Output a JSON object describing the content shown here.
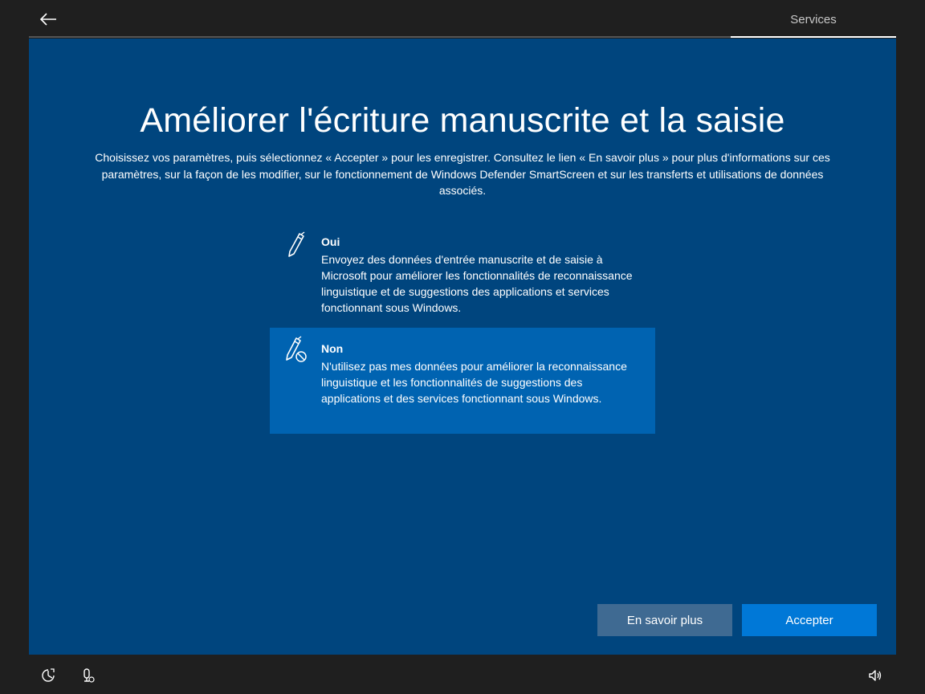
{
  "header": {
    "back_icon": "back-arrow-icon",
    "section_label": "Services"
  },
  "main": {
    "title": "Améliorer l'écriture manuscrite et la saisie",
    "subtitle": "Choisissez vos paramètres, puis sélectionnez « Accepter » pour les enregistrer. Consultez le lien « En savoir plus » pour plus d'informations sur ces paramètres, sur la façon de les modifier, sur le fonctionnement de Windows Defender SmartScreen et sur les transferts et utilisations de données associés.",
    "options": [
      {
        "icon": "pen-icon",
        "title": "Oui",
        "description": "Envoyez des données d'entrée manuscrite et de saisie à Microsoft pour améliorer les fonctionnalités de reconnaissance linguistique et de suggestions des applications et services fonctionnant sous Windows.",
        "selected": false
      },
      {
        "icon": "pen-blocked-icon",
        "title": "Non",
        "description": "N'utilisez pas mes données pour améliorer la reconnaissance linguistique et les fonctionnalités de suggestions des applications et des services fonctionnant sous Windows.",
        "selected": true
      }
    ]
  },
  "buttons": {
    "learn_more": "En savoir plus",
    "accept": "Accepter"
  },
  "footer": {
    "icons": [
      "ease-of-access-icon",
      "microphone-icon",
      "volume-icon"
    ]
  },
  "colors": {
    "background": "#1f1f1f",
    "panel": "#00457e",
    "selected_option": "#0063b1",
    "accept_button": "#0078d7",
    "learn_more_button": "#3f6a92"
  }
}
